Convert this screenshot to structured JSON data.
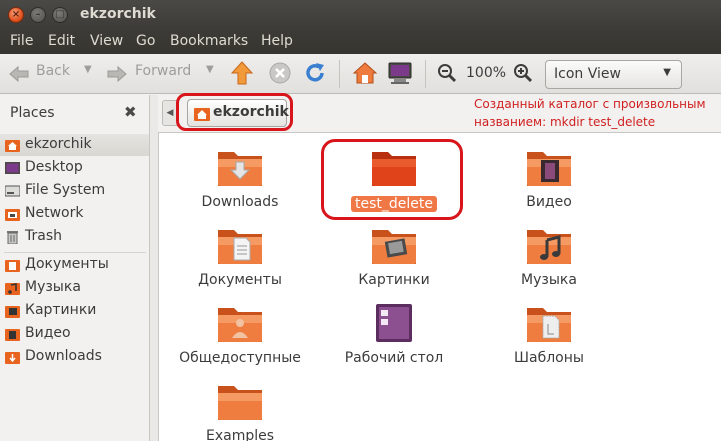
{
  "window": {
    "title": "ekzorchik"
  },
  "menu": [
    "File",
    "Edit",
    "View",
    "Go",
    "Bookmarks",
    "Help"
  ],
  "toolbar": {
    "back_label": "Back",
    "forward_label": "Forward",
    "zoom": "100%",
    "view_mode": "Icon View",
    "icons": [
      "back-arrow-icon",
      "forward-arrow-icon",
      "up-arrow-icon",
      "stop-icon",
      "reload-icon",
      "home-icon",
      "computer-icon",
      "zoom-out-icon",
      "zoom-in-icon"
    ]
  },
  "sidebar": {
    "title": "Places",
    "items": [
      {
        "label": "ekzorchik",
        "icon": "home-folder-icon",
        "selected": true
      },
      {
        "label": "Desktop",
        "icon": "desktop-icon"
      },
      {
        "label": "File System",
        "icon": "drive-icon"
      },
      {
        "label": "Network",
        "icon": "network-icon"
      },
      {
        "label": "Trash",
        "icon": "trash-icon"
      },
      {
        "label": "Документы",
        "icon": "folder-icon"
      },
      {
        "label": "Музыка",
        "icon": "folder-icon"
      },
      {
        "label": "Картинки",
        "icon": "folder-icon"
      },
      {
        "label": "Видео",
        "icon": "folder-icon"
      },
      {
        "label": "Downloads",
        "icon": "folder-icon"
      }
    ]
  },
  "location": {
    "crumb": "ekzorchik"
  },
  "annotation": {
    "line1": "Созданный каталог с произвольным",
    "line2": "названием: mkdir test_delete",
    "color": "#d02020"
  },
  "files": [
    {
      "name": "Downloads",
      "emblem": "download"
    },
    {
      "name": "test_delete",
      "emblem": "none",
      "selected": true
    },
    {
      "name": "Видео",
      "emblem": "video"
    },
    {
      "name": "Документы",
      "emblem": "document"
    },
    {
      "name": "Картинки",
      "emblem": "pictures"
    },
    {
      "name": "Музыка",
      "emblem": "music"
    },
    {
      "name": "Общедоступные",
      "emblem": "public"
    },
    {
      "name": "Рабочий стол",
      "emblem": "desktop"
    },
    {
      "name": "Шаблоны",
      "emblem": "templates"
    },
    {
      "name": "Examples",
      "emblem": "none"
    }
  ],
  "colors": {
    "accent": "#f07746",
    "highlight": "#d7151b",
    "folder": "#e8631e"
  }
}
